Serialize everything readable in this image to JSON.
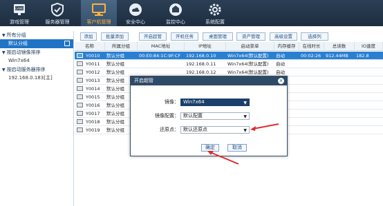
{
  "nav": {
    "items": [
      {
        "label": "游戏管理",
        "icon": "game-icon"
      },
      {
        "label": "服务器管理",
        "icon": "shield-icon"
      },
      {
        "label": "客户机管理",
        "icon": "computer-icon"
      },
      {
        "label": "安全中心",
        "icon": "cloud-icon"
      },
      {
        "label": "监控中心",
        "icon": "monitor-icon"
      },
      {
        "label": "系统配置",
        "icon": "gear-icon"
      }
    ]
  },
  "sidebar": {
    "groups_header": "所有分组",
    "group_item": "默认分组",
    "image_header": "按启动镜像排序",
    "image_item": "Win7x64",
    "server_header": "按启动服务器排序",
    "server_item": "192.168.0.183[主]"
  },
  "toolbar": {
    "buttons": [
      "添加",
      "批量添加",
      "开启超管",
      "开机任务",
      "桌面管理",
      "资产管理",
      "高级设置",
      "选择列"
    ]
  },
  "table": {
    "headers": [
      "名称",
      "所属分组",
      "MAC地址",
      "IP地址",
      "启动菜单",
      "内存缓存",
      "在线时长",
      "总读数",
      "IO速度"
    ],
    "rows": [
      {
        "name": "Y0010",
        "group": "默认分组",
        "mac": "00:E0:84:1C:9F:CF",
        "ip": "192.168.0.10",
        "menu": "Win7x64(默认配置)",
        "cache": "自动",
        "online": "00:02:26",
        "read": "912.44MB",
        "io": "182.8"
      },
      {
        "name": "Y0011",
        "group": "默认分组",
        "mac": "",
        "ip": "192.168.0.11",
        "menu": "Win7x64(默认配置)",
        "cache": "自动",
        "online": "",
        "read": "",
        "io": ""
      },
      {
        "name": "Y0012",
        "group": "默认分组",
        "mac": "",
        "ip": "192.168.0.12",
        "menu": "Win7x64(默认配置)",
        "cache": "自动",
        "online": "",
        "read": "",
        "io": ""
      },
      {
        "name": "Y0013",
        "group": "默认分组",
        "mac": "",
        "ip": "",
        "menu": "",
        "cache": "",
        "online": "",
        "read": "",
        "io": ""
      },
      {
        "name": "Y0014",
        "group": "默认分组",
        "mac": "",
        "ip": "",
        "menu": "",
        "cache": "",
        "online": "",
        "read": "",
        "io": ""
      },
      {
        "name": "Y0015",
        "group": "默认分组",
        "mac": "",
        "ip": "",
        "menu": "",
        "cache": "",
        "online": "",
        "read": "",
        "io": ""
      },
      {
        "name": "Y0016",
        "group": "默认分组",
        "mac": "",
        "ip": "",
        "menu": "",
        "cache": "",
        "online": "",
        "read": "",
        "io": ""
      },
      {
        "name": "Y0017",
        "group": "默认分组",
        "mac": "",
        "ip": "",
        "menu": "",
        "cache": "",
        "online": "",
        "read": "",
        "io": ""
      },
      {
        "name": "Y0018",
        "group": "默认分组",
        "mac": "",
        "ip": "",
        "menu": "",
        "cache": "",
        "online": "",
        "read": "",
        "io": ""
      },
      {
        "name": "Y0019",
        "group": "默认分组",
        "mac": "",
        "ip": "",
        "menu": "",
        "cache": "",
        "online": "",
        "read": "",
        "io": ""
      }
    ]
  },
  "modal": {
    "title": "开启超管",
    "image_label": "镜像：",
    "image_value": "Win7x64",
    "config_label": "镜像配置：",
    "config_value": "默认配置",
    "restore_label": "还原点：",
    "restore_value": "默认还原点",
    "ok": "确定",
    "cancel": "取消"
  },
  "colors": {
    "annotation_arrow": "#e02a2a",
    "nav_active_text": "#ffb33a",
    "selected_row": "#2a7fd1"
  }
}
